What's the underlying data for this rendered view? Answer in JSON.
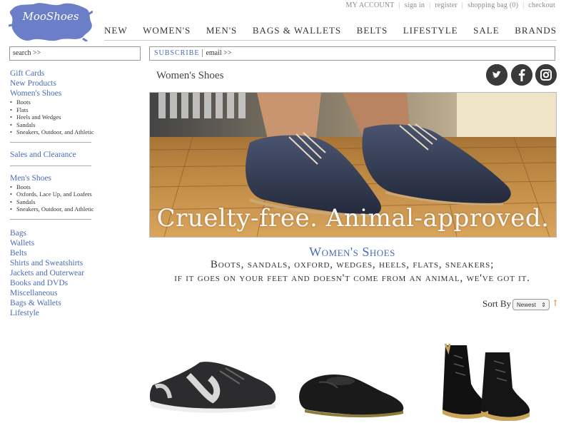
{
  "brand": {
    "logo_text": "MooShoes"
  },
  "account_links": [
    "MY ACCOUNT",
    "sign in",
    "register",
    "shopping bag (0)",
    "checkout"
  ],
  "nav": [
    "New",
    "Women's",
    "Men's",
    "Bags & Wallets",
    "Belts",
    "Lifestyle",
    "Sale",
    "Brands"
  ],
  "search": {
    "placeholder": "search >>"
  },
  "subscribe": {
    "button": "SUBSCRIBE",
    "email_placeholder": "email >>"
  },
  "sidebar": {
    "group1": [
      "Gift Cards",
      "New Products",
      "Women's Shoes"
    ],
    "women_sub": [
      "Boots",
      "Flats",
      "Heels and Wedges",
      "Sandals",
      "Sneakers, Outdoor, and Athletic"
    ],
    "sales": "Sales and Clearance",
    "mens": "Men's Shoes",
    "mens_sub": [
      "Boots",
      "Oxfords, Lace Up, and Loafers",
      "Sandals",
      "Sneakers, Outdoor, and Athletic"
    ],
    "group3": [
      "Bags",
      "Wallets",
      "Belts",
      "Shirts and Sweatshirts",
      "Jackets and Outerwear",
      "Books and DVDs",
      "Miscellaneous",
      "Bags & Wallets",
      "Lifestyle"
    ]
  },
  "page": {
    "title": "Women's Shoes",
    "hero_caption": "Cruelty-free. Animal-approved.",
    "section_title": "Women's Shoes",
    "tagline_1": "Boots, sandals, oxford, wedges, heels, flats, sneakers;",
    "tagline_2": "if it goes on your feet and doesn't come from an animal, we've got it."
  },
  "social": [
    "twitter-icon",
    "facebook-icon",
    "instagram-icon"
  ],
  "sort": {
    "label": "Sort By",
    "value": "Newest"
  },
  "colors": {
    "link": "#4a6bb5",
    "logo": "#6b7fc8",
    "accent_arrow": "#e08020"
  }
}
